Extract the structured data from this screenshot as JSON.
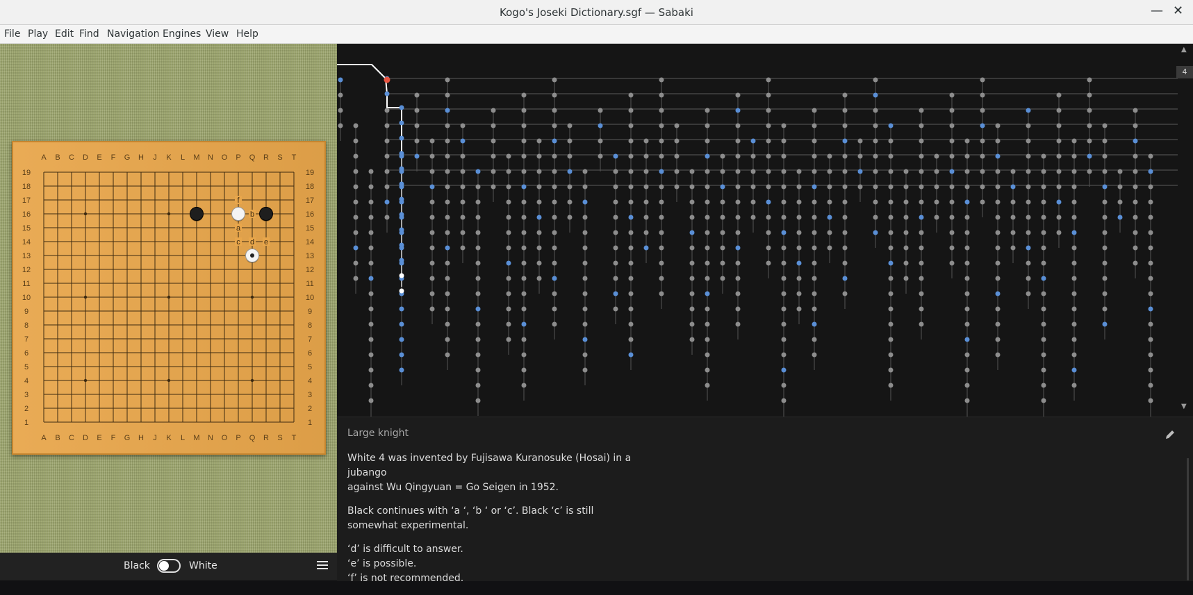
{
  "window": {
    "title": "Kogo's Joseki Dictionary.sgf — Sabaki",
    "minimize_glyph": "—",
    "close_glyph": "✕"
  },
  "menu": [
    "File",
    "Play",
    "Edit",
    "Find",
    "Navigation",
    "Engines",
    "View",
    "Help"
  ],
  "board": {
    "columns": [
      "A",
      "B",
      "C",
      "D",
      "E",
      "F",
      "G",
      "H",
      "J",
      "K",
      "L",
      "M",
      "N",
      "O",
      "P",
      "Q",
      "R",
      "S",
      "T"
    ],
    "rows": [
      "19",
      "18",
      "17",
      "16",
      "15",
      "14",
      "13",
      "12",
      "11",
      "10",
      "9",
      "8",
      "7",
      "6",
      "5",
      "4",
      "3",
      "2",
      "1"
    ],
    "stones": [
      {
        "color": "black",
        "point": "M16"
      },
      {
        "color": "white",
        "point": "P16"
      },
      {
        "color": "black",
        "point": "R16"
      },
      {
        "color": "white",
        "point": "Q13",
        "last_move": true
      }
    ],
    "labels": [
      {
        "text": "f",
        "point": "P17"
      },
      {
        "text": "b",
        "point": "Q16"
      },
      {
        "text": "a",
        "point": "P15"
      },
      {
        "text": "c",
        "point": "P14"
      },
      {
        "text": "d",
        "point": "Q14"
      },
      {
        "text": "e",
        "point": "R14"
      }
    ]
  },
  "footer": {
    "black_label": "Black",
    "white_label": "White",
    "toggle_state": "off"
  },
  "game_tree": {
    "current_move_number": "4",
    "colors": {
      "main_path": "#ffffff",
      "current_node": "#e8533f",
      "node": "#8d8d8d",
      "highlighted_branch": "#5a8fd6"
    }
  },
  "comment": {
    "title": "Large knight",
    "paragraphs": [
      [
        "White 4 was invented by Fujisawa Kuranosuke (Hosai) in a jubango",
        "against Wu Qingyuan = Go Seigen in 1952."
      ],
      [
        "Black continues with ‘a ‘, ‘b ‘ or ‘c’. Black ‘c’ is still",
        "somewhat experimental."
      ],
      [
        "‘d’ is difficult to answer.",
        "‘e’ is possible.",
        "‘f’ is not recommended."
      ]
    ]
  }
}
